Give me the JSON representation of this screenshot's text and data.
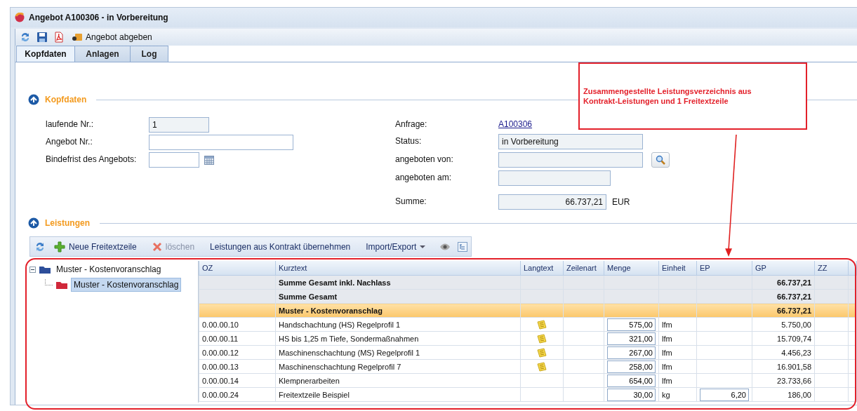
{
  "window": {
    "title": "Angebot A100306 - in Vorbereitung"
  },
  "toolbar": {
    "submit_label": "Angebot abgeben"
  },
  "tabs": [
    {
      "label": "Kopfdaten",
      "selected": true
    },
    {
      "label": "Anlagen",
      "selected": false
    },
    {
      "label": "Log",
      "selected": false
    }
  ],
  "kopfdaten": {
    "title": "Kopfdaten",
    "expanded": true,
    "left_fields": [
      {
        "label": "laufende Nr.:",
        "value": "1",
        "readonly": true,
        "kind": "text"
      },
      {
        "label": "Angebot Nr.:",
        "readonly": false,
        "kind": "text"
      },
      {
        "label": "Bindefrist des Angebots:",
        "readonly": false,
        "kind": "date"
      }
    ],
    "right_fields": [
      {
        "label": "Anfrage:",
        "value": "A100306",
        "kind": "link"
      },
      {
        "label": "Status:",
        "value": "in Vorbereitung",
        "kind": "text"
      },
      {
        "label": "angeboten von:",
        "kind": "lookup"
      },
      {
        "label": "angeboten am:",
        "kind": "text"
      },
      {
        "label": "Summe:",
        "value": "66.737,21",
        "kind": "amount",
        "unit": "EUR"
      }
    ]
  },
  "annotation": {
    "text": "Zusammengestellte Leistungsverzeichnis  aus Kontrakt-Leistungen und 1 Freitextzeile"
  },
  "leistungen": {
    "title": "Leistungen",
    "expanded": true,
    "toolbar": [
      {
        "kind": "refresh"
      },
      {
        "kind": "add",
        "label": "Neue Freitextzeile",
        "disabled": false
      },
      {
        "kind": "delete",
        "label": "löschen",
        "disabled": true
      },
      {
        "kind": "plain",
        "label": "Leistungen aus Kontrakt übernehmen",
        "disabled": false
      },
      {
        "kind": "menu",
        "label": "Import/Export",
        "disabled": false
      },
      {
        "kind": "eye"
      },
      {
        "kind": "tree"
      }
    ],
    "tree": [
      {
        "label": "Muster - Kostenvoranschlag",
        "expanded": true,
        "selected": false,
        "children": [
          {
            "label": "Muster - Kostenvoranschlag",
            "selected": true
          }
        ]
      }
    ],
    "table": {
      "columns": [
        "OZ",
        "Kurztext",
        "Langtext",
        "Zeilenart",
        "Menge",
        "Einheit",
        "EP",
        "GP",
        "ZZ"
      ],
      "rows": [
        {
          "kind": "sum",
          "kurztext": "Summe Gesamt inkl. Nachlass",
          "langtext": false,
          "gp": "66.737,21"
        },
        {
          "kind": "sum",
          "kurztext": "Summe Gesamt",
          "langtext": false,
          "gp": "66.737,21"
        },
        {
          "kind": "group",
          "kurztext": "Muster - Kostenvoranschlag",
          "langtext": false,
          "gp": "66.737,21"
        },
        {
          "kind": "item",
          "oz": "0.00.00.10",
          "kurztext": "Handschachtung (HS) Regelprofil 1",
          "langtext": true,
          "menge": "575,00",
          "einheit": "lfm",
          "gp": "5.750,00"
        },
        {
          "kind": "item",
          "oz": "0.00.00.11",
          "kurztext": "HS bis 1,25 m Tiefe, Sondermaßnahmen",
          "langtext": true,
          "menge": "321,00",
          "einheit": "lfm",
          "gp": "15.709,74"
        },
        {
          "kind": "item",
          "oz": "0.00.00.12",
          "kurztext": "Maschinenschachtung (MS) Regelprofil 1",
          "langtext": true,
          "menge": "267,00",
          "einheit": "lfm",
          "gp": "4.456,23"
        },
        {
          "kind": "item",
          "oz": "0.00.00.13",
          "kurztext": "Maschinenschachtung Regelprofil 7",
          "langtext": true,
          "menge": "258,00",
          "einheit": "lfm",
          "gp": "16.901,58"
        },
        {
          "kind": "item",
          "oz": "0.00.00.14",
          "kurztext": "Klempnerarbeiten",
          "langtext": false,
          "menge": "654,00",
          "einheit": "lfm",
          "gp": "23.733,66"
        },
        {
          "kind": "item",
          "oz": "0.00.00.24",
          "kurztext": "Freitextzeile Beispiel",
          "langtext": false,
          "menge": "30,00",
          "einheit": "kg",
          "ep": "6,20",
          "gp": "186,00"
        }
      ]
    }
  }
}
